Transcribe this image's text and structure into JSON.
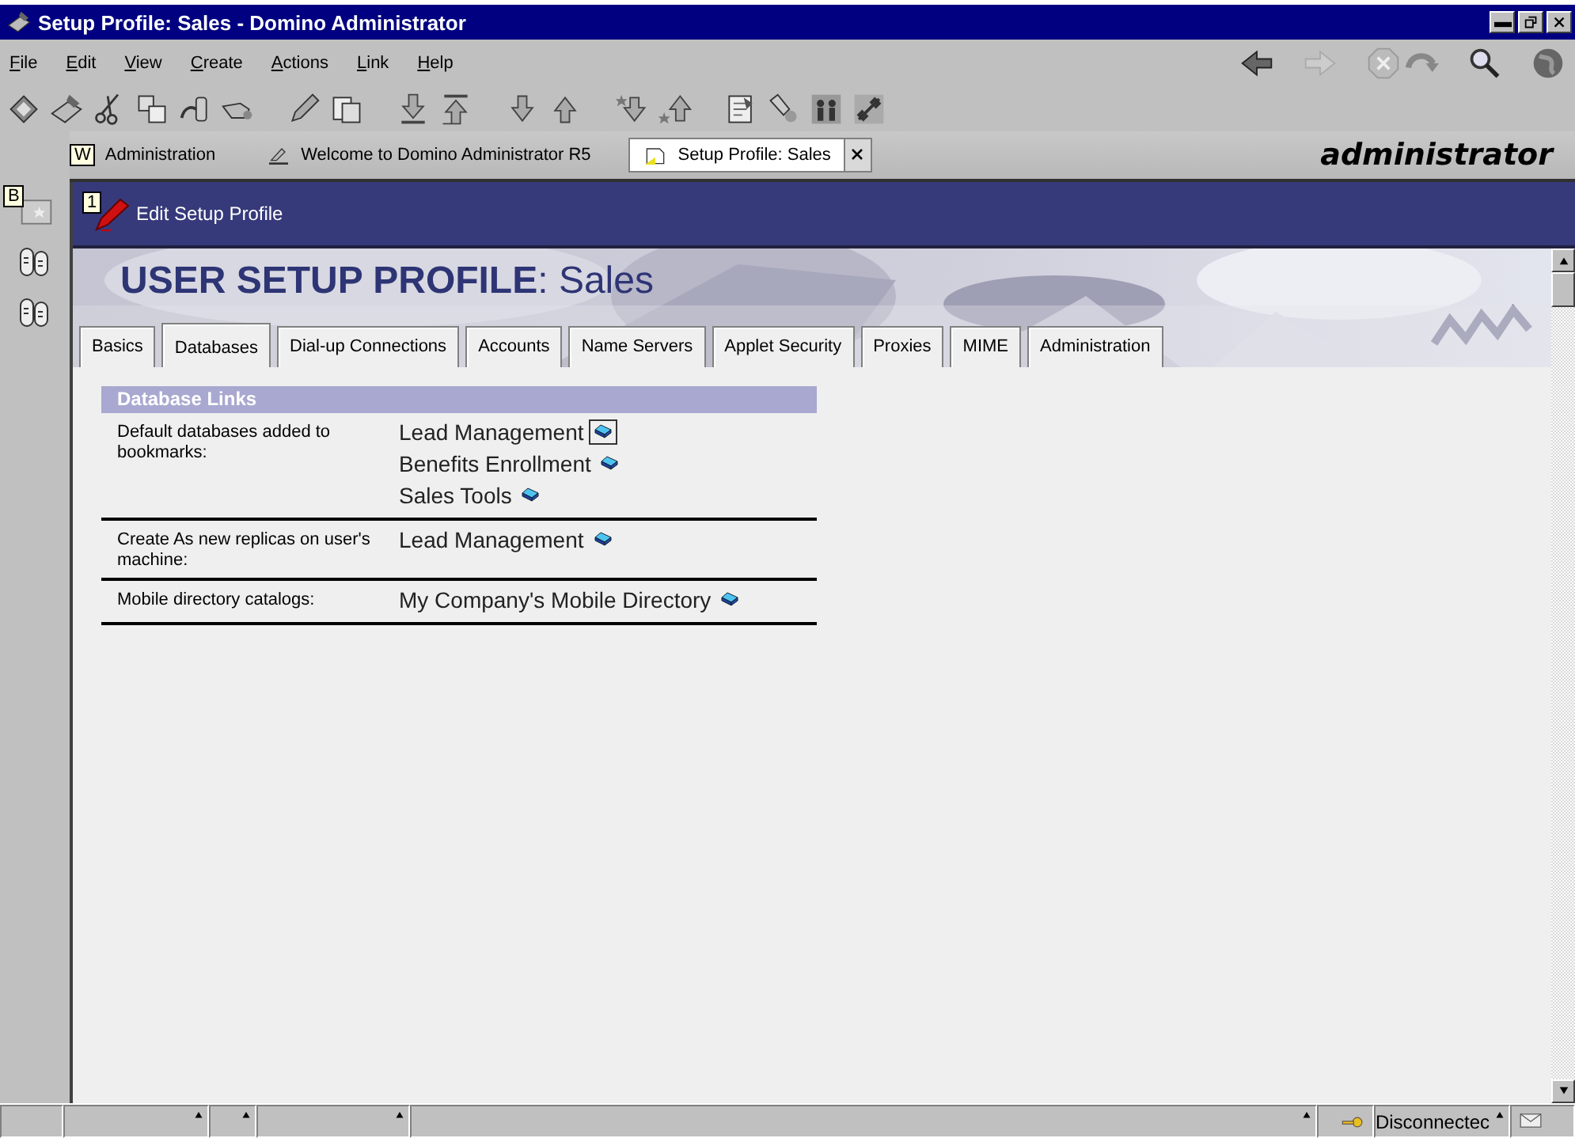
{
  "window": {
    "title": "Setup Profile: Sales - Domino Administrator"
  },
  "menu": [
    {
      "label": "File"
    },
    {
      "label": "Edit"
    },
    {
      "label": "View"
    },
    {
      "label": "Create"
    },
    {
      "label": "Actions"
    },
    {
      "label": "Link"
    },
    {
      "label": "Help"
    }
  ],
  "window_tabs": [
    {
      "label": "Administration",
      "key_hint": "W",
      "selected": false
    },
    {
      "label": "Welcome to Domino Administrator R5",
      "selected": false
    },
    {
      "label": "Setup Profile: Sales",
      "selected": true
    }
  ],
  "user": "administrator",
  "sidebar": {
    "key_hint": "B"
  },
  "action_bar": {
    "key_hint": "1",
    "actions": [
      {
        "label": "Edit Setup Profile"
      }
    ]
  },
  "form": {
    "title": "**USER SETUP PROFILE**: Sales",
    "tabs": [
      {
        "label": "Basics",
        "selected": false
      },
      {
        "label": "Databases",
        "selected": true
      },
      {
        "label": "Dial-up Connections",
        "selected": false
      },
      {
        "label": "Accounts",
        "selected": false
      },
      {
        "label": "Name Servers",
        "selected": false
      },
      {
        "label": "Applet Security",
        "selected": false
      },
      {
        "label": "Proxies",
        "selected": false
      },
      {
        "label": "MIME",
        "selected": false
      },
      {
        "label": "Administration",
        "selected": false
      }
    ],
    "section": {
      "title": "Database Links",
      "rows": [
        {
          "label": "Default databases added to bookmarks:",
          "links": [
            {
              "label": "Lead Management",
              "focused": true
            },
            {
              "label": "Benefits Enrollment",
              "focused": false
            },
            {
              "label": "Sales Tools",
              "focused": false
            }
          ]
        },
        {
          "label": "Create As new replicas on user's machine:",
          "links": [
            {
              "label": "Lead Management",
              "focused": false
            }
          ]
        },
        {
          "label": "Mobile directory catalogs:",
          "links": [
            {
              "label": "My Company's Mobile Directory",
              "focused": false
            }
          ]
        }
      ]
    }
  },
  "status_bar": {
    "connection": "Disconnectec"
  }
}
